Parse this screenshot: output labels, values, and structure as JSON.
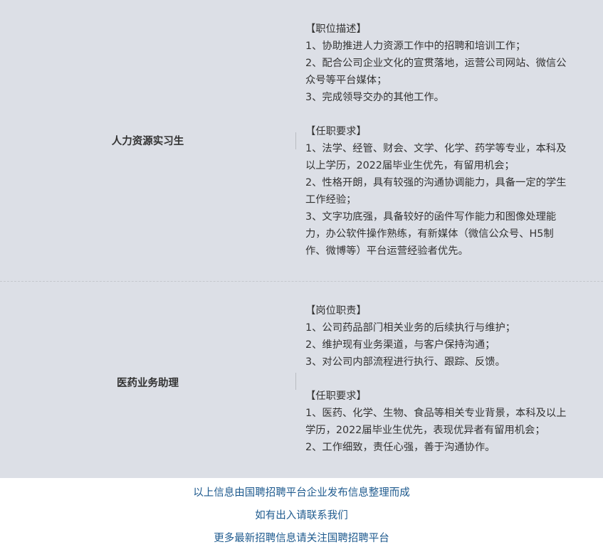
{
  "jobs": [
    {
      "title": "人力资源实习生",
      "lines": [
        "【职位描述】",
        "1、协助推进人力资源工作中的招聘和培训工作；",
        "2、配合公司企业文化的宣贯落地，运营公司网站、微信公",
        "众号等平台媒体；",
        "3、完成领导交办的其他工作。",
        "",
        "【任职要求】",
        "1、法学、经管、财会、文学、化学、药学等专业，本科及",
        "以上学历，2022届毕业生优先，有留用机会；",
        "2、性格开朗，具有较强的沟通协调能力，具备一定的学生",
        "工作经验；",
        "3、文字功底强，具备较好的函件写作能力和图像处理能",
        "力，办公软件操作熟练，有新媒体（微信公众号、H5制",
        "作、微博等）平台运营经验者优先。"
      ]
    },
    {
      "title": "医药业务助理",
      "lines": [
        "【岗位职责】",
        "1、公司药品部门相关业务的后续执行与维护；",
        "2、维护现有业务渠道，与客户保持沟通；",
        "3、对公司内部流程进行执行、跟踪、反馈。",
        "",
        "【任职要求】",
        "1、医药、化学、生物、食品等相关专业背景，本科及以上",
        "学历，2022届毕业生优先，表现优异者有留用机会；",
        "2、工作细致，责任心强，善于沟通协作。"
      ]
    }
  ],
  "footer": {
    "line1": "以上信息由国聘招聘平台企业发布信息整理而成",
    "line2": "如有出入请联系我们",
    "line3": "更多最新招聘信息请关注国聘招聘平台"
  },
  "colors": {
    "table_background": "#dcdfe6",
    "body_text": "#333333",
    "footer_text": "#1e5a8e"
  }
}
